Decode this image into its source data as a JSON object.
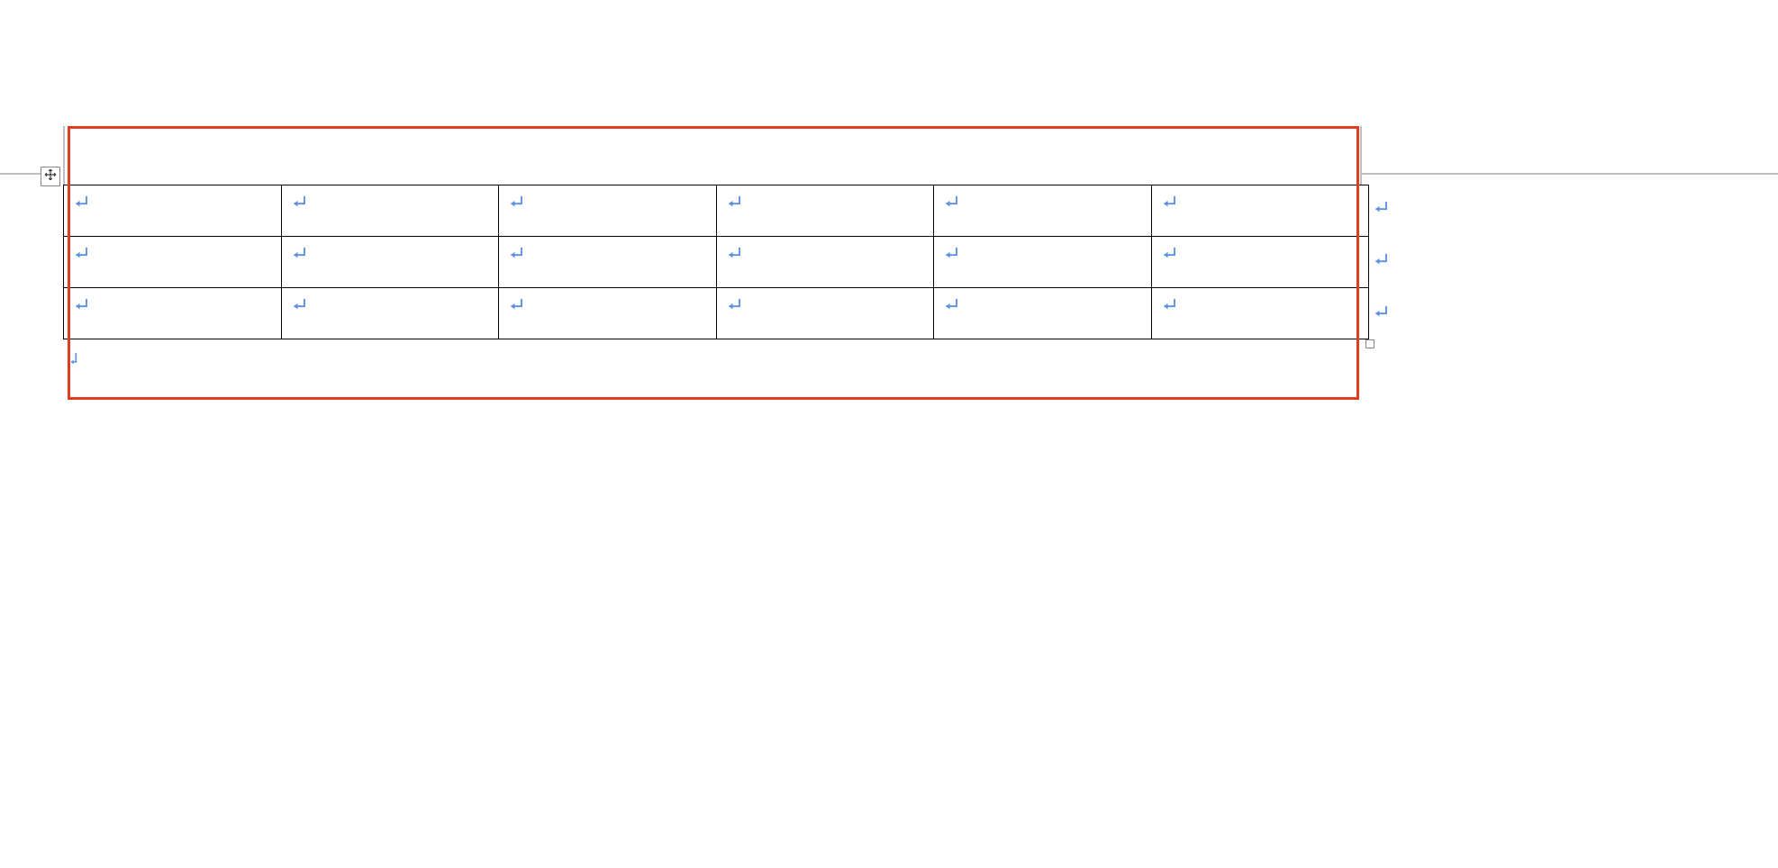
{
  "marks": {
    "cell_return": "↵",
    "trailing_return": "↵",
    "row_end": "↵"
  },
  "table": {
    "rows": 3,
    "cols": 6,
    "cells": [
      [
        "",
        "",
        "",
        "",
        "",
        ""
      ],
      [
        "",
        "",
        "",
        "",
        "",
        ""
      ],
      [
        "",
        "",
        "",
        "",
        "",
        ""
      ]
    ]
  }
}
